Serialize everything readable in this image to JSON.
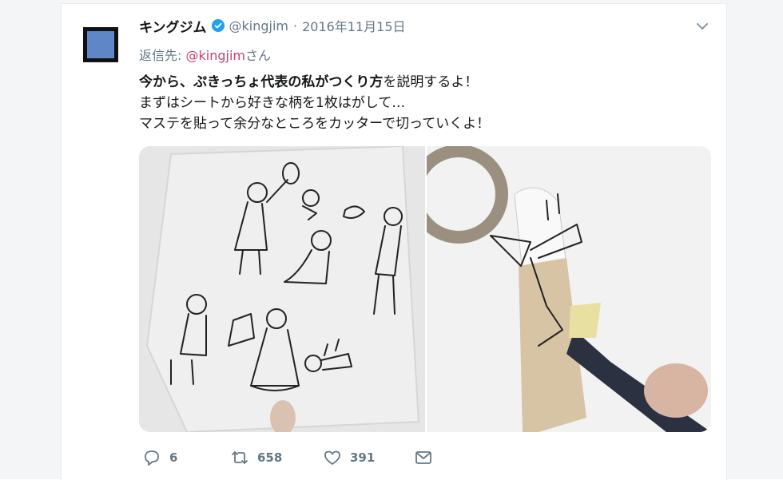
{
  "tweet": {
    "author_name": "キングジム",
    "handle": "@kingjim",
    "separator": "·",
    "date": "2016年11月15日",
    "reply_prefix": "返信先:",
    "reply_mention": "@kingjim",
    "reply_suffix": "さん",
    "text": {
      "line1_bold": "今から、ぷきっちょ代表の私がつくり方",
      "line1_rest": "を説明するよ！",
      "line2": "まずはシートから好きな柄を1枚はがして…",
      "line3": "マステを貼って余分なところをカッターで切っていくよ！"
    }
  },
  "actions": {
    "reply_count": "6",
    "retweet_count": "658",
    "like_count": "391"
  },
  "colors": {
    "accent_mention": "#c4436e",
    "verified": "#1da1f2",
    "secondary_text": "#657786",
    "avatar_blue": "#5f86c6"
  },
  "icons": [
    "verified-badge-icon",
    "chevron-down-icon",
    "reply-icon",
    "retweet-icon",
    "like-icon",
    "message-icon"
  ]
}
